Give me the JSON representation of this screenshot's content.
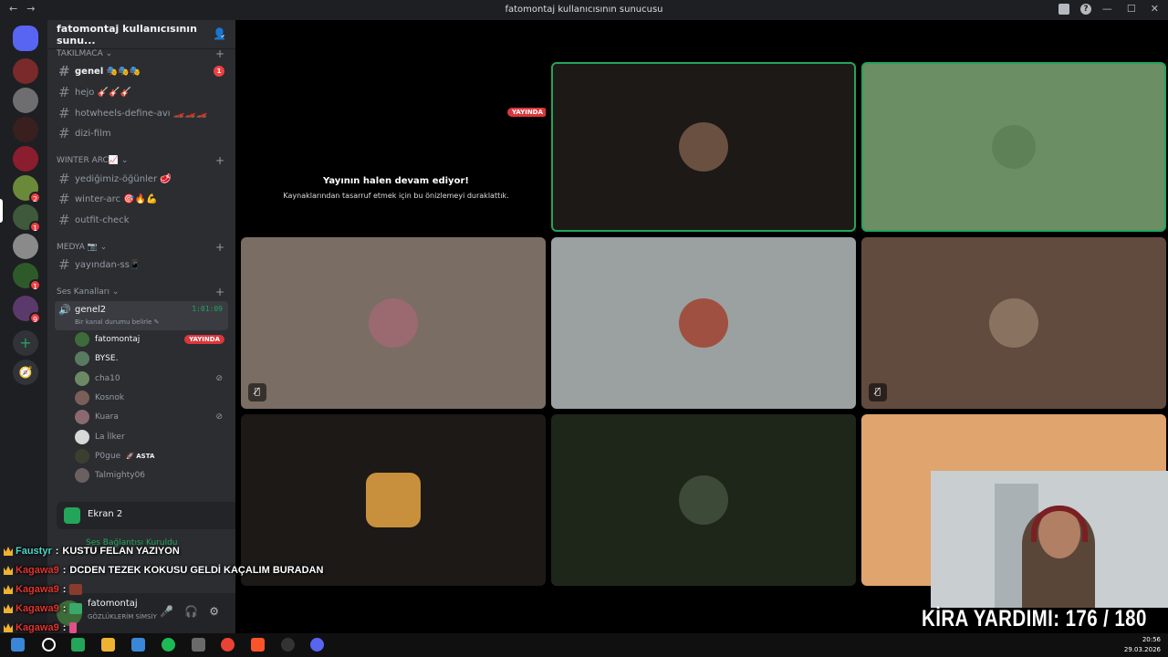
{
  "window": {
    "title": "fatomontaj kullanıcısının sunucusu",
    "back": "←",
    "forward": "→",
    "controls": [
      "—",
      "☐",
      "✕"
    ],
    "help_icon": "?"
  },
  "server": {
    "name": "fatomontaj kullanıcısının sunu...",
    "chevron": "⌄",
    "categories": {
      "takilmaca": "TAKILMACA ⌄",
      "winter": "WINTER ARC📈 ⌄",
      "medya": "MEDYA 📷 ⌄",
      "ses": "Ses Kanalları ⌄"
    },
    "channels": {
      "genel": {
        "name": "genel 🎭🎭🎭",
        "mentions": "1"
      },
      "hejo": {
        "name": "hejo 🎸🎸🎸"
      },
      "hotwheels": {
        "name": "hotwheels-define-avı 🏎️🏎️🏎️"
      },
      "dizi": {
        "name": "dizi-film"
      },
      "yedigimiz": {
        "name": "yediğimiz-öğünler 🥩"
      },
      "winter_arc": {
        "name": "winter-arc 🎯🔥💪"
      },
      "outfit": {
        "name": "outfit-check"
      },
      "yayindan": {
        "name": "yayından-ss📱"
      }
    },
    "voice": {
      "name": "genel2",
      "time": "1:01:09",
      "status": "Bir kanal durumu belirle ✎",
      "live_label": "YAYINDA",
      "users": [
        {
          "name": "fatomontaj",
          "live": true,
          "color": "#3e6b3a"
        },
        {
          "name": "BYSE.",
          "live": false,
          "color": "#5a7a5f"
        },
        {
          "name": "cha10",
          "muted": true,
          "color": "#6b8a64"
        },
        {
          "name": "Kosnok",
          "color": "#7a5e58"
        },
        {
          "name": "Kuara",
          "muted": true,
          "color": "#8a6a70"
        },
        {
          "name": "La İlker",
          "color": "#d8d8d8"
        },
        {
          "name": "P0gue",
          "tag": "🚀 ASTA",
          "color": "#39402f"
        },
        {
          "name": "Talmighty06",
          "color": "#6a6060"
        }
      ]
    }
  },
  "guild_badges": [
    "2",
    "1",
    "1",
    "9"
  ],
  "guild_actions": [
    "+",
    "🧭"
  ],
  "screen_share": {
    "label": "Ekran 2",
    "close": "✕"
  },
  "voice_connected": "Ses Bağlantısı Kuruldu",
  "user": {
    "name": "fatomontaj",
    "status": "GÖZLÜKLERİM SİMSİY",
    "mic": "🎤",
    "headset": "🎧",
    "settings": "⚙"
  },
  "stage": {
    "paused_title": "Yayının halen devam ediyor!",
    "paused_sub": "Kaynaklarından tasarruf etmek için bu önizlemeyi duraklattık.",
    "live_label": "YAYINDA",
    "mute_glyph": "🎙̸"
  },
  "overlay": {
    "kira_text": "KİRA YARDIMI:  176 / 180",
    "chat": [
      {
        "user": "Faustyr",
        "sep": ":",
        "text": "KUSTU FELAN YAZIYON",
        "user_color": "teal"
      },
      {
        "user": "Kagawa9",
        "sep": ":",
        "text": "DCDEN TEZEK KOKUSU GELDİ KAÇALIM BURADAN"
      },
      {
        "user": "Kagawa9",
        "sep": ":",
        "text": ""
      },
      {
        "user": "Kagawa9",
        "sep": ":",
        "text": ""
      },
      {
        "user": "Kagawa9",
        "sep": ":",
        "text": ""
      },
      {
        "user": "Kagawa9",
        "sep": ":",
        "text": ""
      }
    ]
  },
  "taskbar": {
    "time": "20:56",
    "date": "29.03.2026"
  },
  "colors": {
    "discord_bg": "#2b2d31",
    "guild_bg": "#1e1f22",
    "accent_green": "#23a55a",
    "live_red": "#da373c",
    "tile_cam_frame": "#c9ced1"
  }
}
